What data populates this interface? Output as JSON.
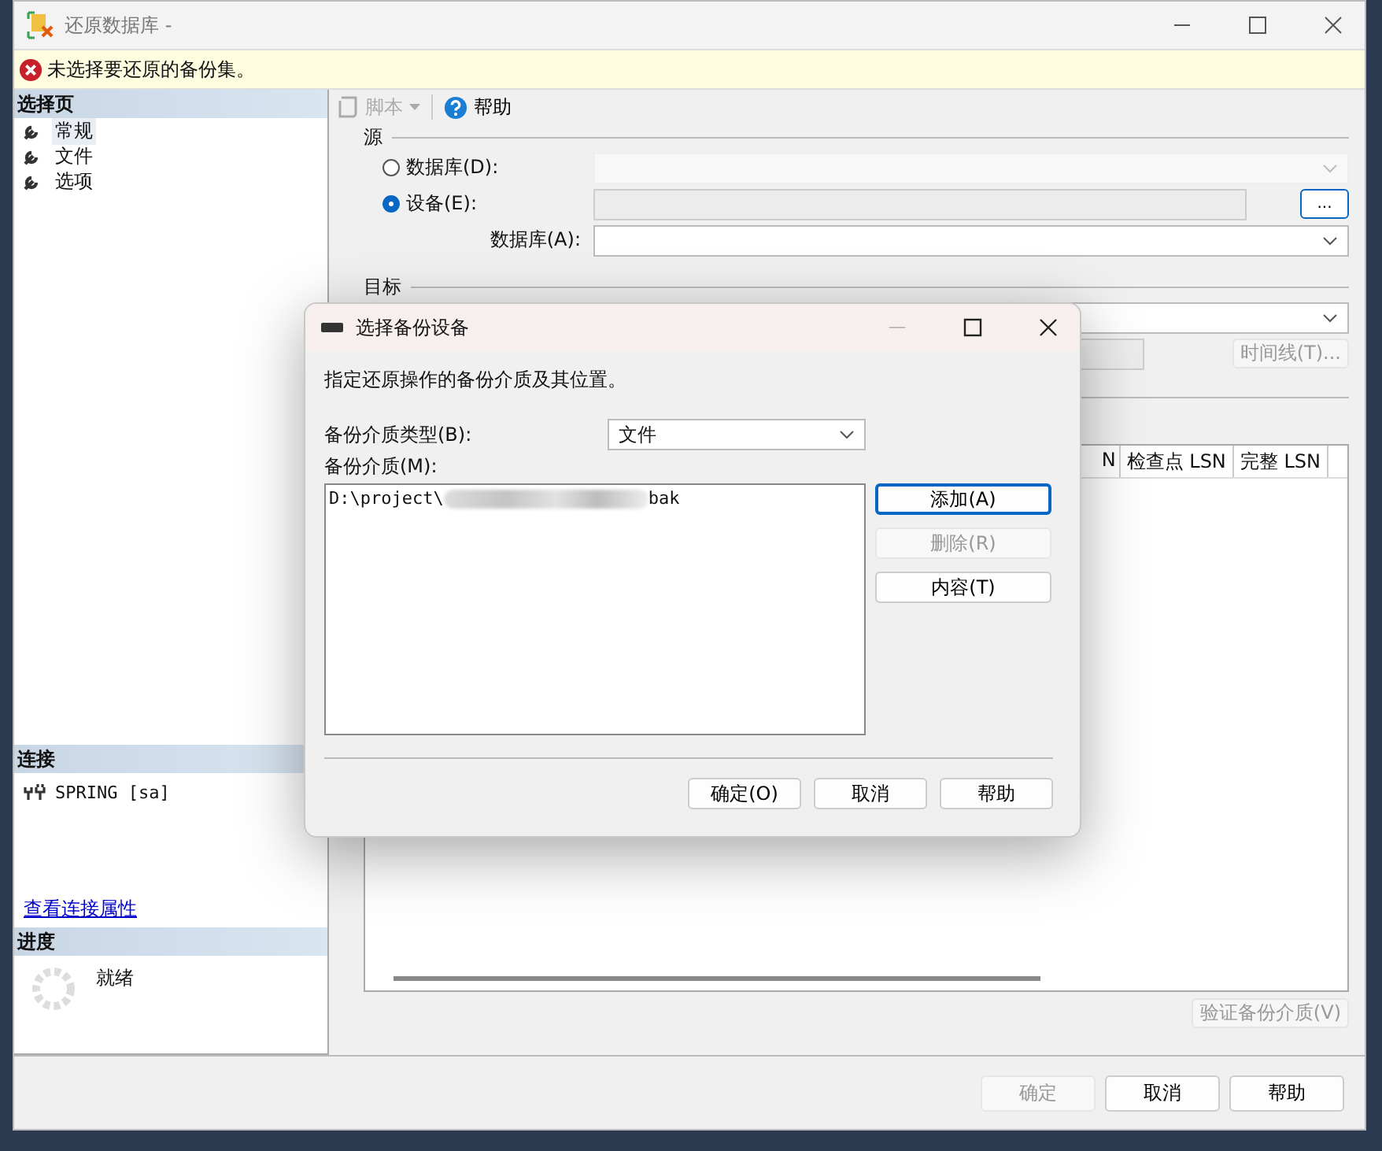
{
  "window": {
    "title": "还原数据库 -"
  },
  "warning": {
    "text": "未选择要还原的备份集。"
  },
  "sidebar": {
    "pages_header": "选择页",
    "pages": [
      {
        "label": "常规",
        "selected": true
      },
      {
        "label": "文件",
        "selected": false
      },
      {
        "label": "选项",
        "selected": false
      }
    ],
    "connection_header": "连接",
    "connection": "SPRING [sa]",
    "connection_link": "查看连接属性",
    "progress_header": "进度",
    "progress_status": "就绪"
  },
  "toolbar": [
    {
      "label": "脚本",
      "kind": "script",
      "disabled": true
    },
    {
      "label": "帮助",
      "kind": "help",
      "disabled": false
    }
  ],
  "source": {
    "heading": "源",
    "options": [
      {
        "label": "数据库(D):",
        "selected": false
      },
      {
        "label": "设备(E):",
        "selected": true
      }
    ],
    "browse_button": "...",
    "database_label": "数据库(A):"
  },
  "target": {
    "heading": "目标",
    "timeline_button": "时间线(T)..."
  },
  "table": {
    "columns": [
      "N",
      "检查点 LSN",
      "完整 LSN"
    ]
  },
  "verify_button": "验证备份介质(V)",
  "buttons": [
    {
      "label": "确定",
      "disabled": true
    },
    {
      "label": "取消",
      "disabled": false
    },
    {
      "label": "帮助",
      "disabled": false
    }
  ],
  "dialog": {
    "title": "选择备份设备",
    "description": "指定还原操作的备份介质及其位置。",
    "type_label": "备份介质类型(B):",
    "type_value": "文件",
    "media_label": "备份介质(M):",
    "media": [
      {
        "prefix": "D:\\project\\",
        "suffix": "bak"
      }
    ],
    "side_buttons": [
      {
        "label": "添加(A)",
        "disabled": false,
        "focused": true
      },
      {
        "label": "删除(R)",
        "disabled": true,
        "focused": false
      },
      {
        "label": "内容(T)",
        "disabled": false,
        "focused": false
      }
    ],
    "buttons": [
      "确定(O)",
      "取消",
      "帮助"
    ]
  }
}
